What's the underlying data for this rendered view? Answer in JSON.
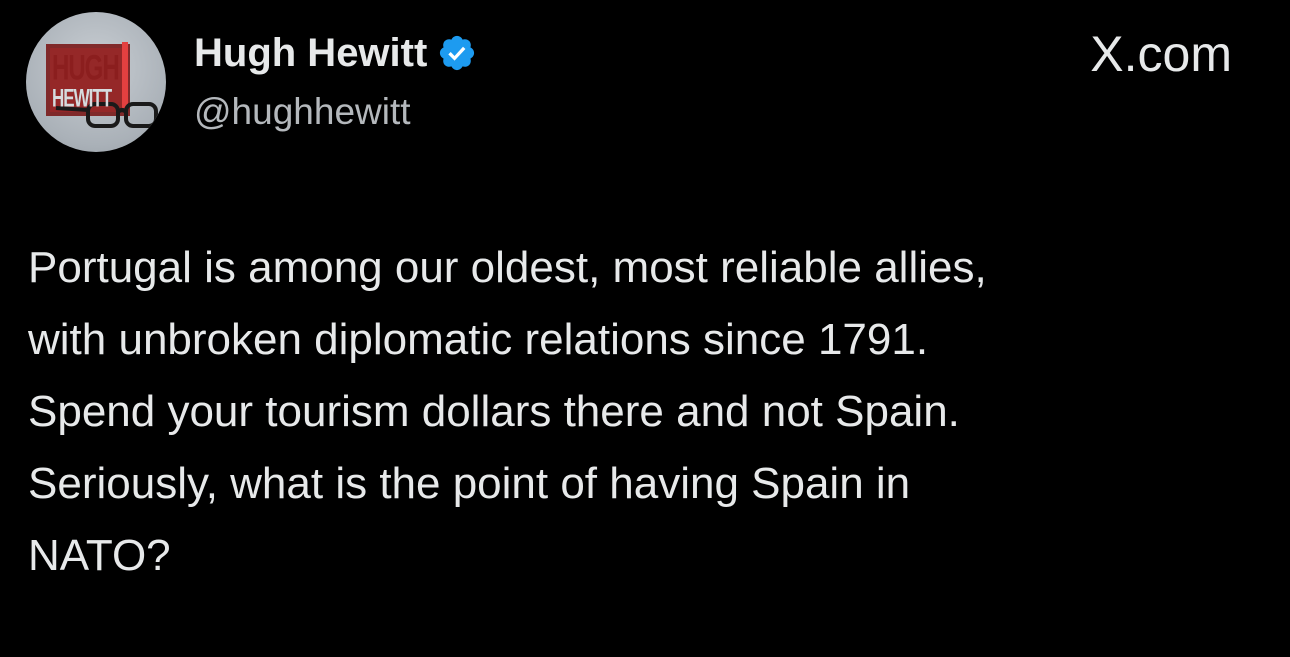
{
  "header": {
    "avatar": {
      "logo_line_1": "HUGH",
      "logo_line_2": "HEWITT",
      "icon": "profile-avatar"
    },
    "display_name": "Hugh Hewitt",
    "verified_icon": "verified-badge-icon",
    "handle": "@hughhewitt",
    "brand": "X.com"
  },
  "tweet": {
    "text": "Portugal is among our oldest, most reliable allies,\nwith unbroken diplomatic relations since 1791.\nSpend your tourism dollars there and not Spain.\nSeriously, what is the point of having Spain in\nNATO?"
  },
  "colors": {
    "background": "#000000",
    "text_primary": "#e7e9ea",
    "text_secondary": "#b4b8bc",
    "verified_blue": "#1d9bf0",
    "logo_red": "#8b1e1e"
  }
}
